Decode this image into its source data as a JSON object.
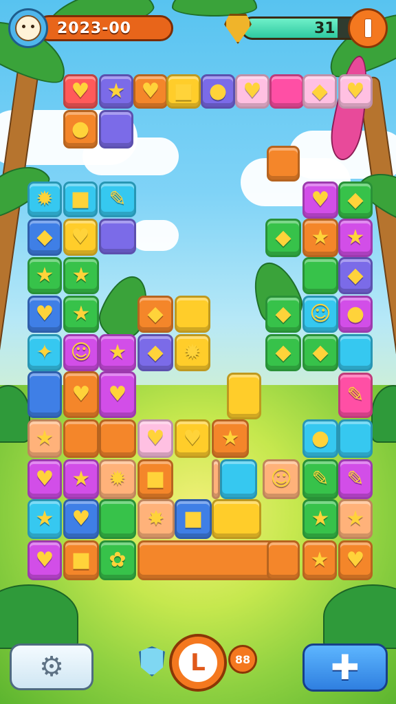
{
  "hud": {
    "score": "2023-00",
    "level_value": "31",
    "level_progress": 0.75
  },
  "icons": {
    "avatar": "avatar-face-icon",
    "gem": "gem-icon",
    "pause": "pause-icon",
    "settings": "gear-icon",
    "shield": "shield-icon",
    "add": "plus-icon"
  },
  "bottom": {
    "center_label": "L",
    "moves_badge": "88"
  },
  "palette": {
    "orange": "#f4862a",
    "purple": "#7b6be8",
    "yellow": "#ffcd2a",
    "pink": "#ff4fa5",
    "lightpink": "#ffc0e2",
    "blue": "#3f7fe6",
    "cyan": "#36c8f0",
    "green": "#37c24a",
    "magenta": "#d24ee8",
    "peach": "#ffb27a",
    "red": "#ff5a5a"
  },
  "tiles": [
    {
      "color": "orange",
      "glyph": "◆"
    },
    {
      "color": "purple",
      "glyph": "★"
    },
    {
      "color": "orange",
      "glyph": "♥"
    },
    {
      "color": "yellow",
      "glyph": "■"
    },
    {
      "color": "purple",
      "glyph": "●"
    },
    {
      "color": "lightpink",
      "glyph": "♥"
    },
    {
      "color": "pink",
      "glyph": ""
    },
    {
      "color": "lightpink",
      "glyph": "◆"
    },
    {
      "color": "lightpink",
      "glyph": "♥"
    },
    {
      "color": "orange",
      "glyph": "●"
    },
    {
      "color": "purple",
      "glyph": ""
    },
    {
      "color": "orange",
      "glyph": ""
    },
    {
      "color": "cyan",
      "glyph": "✹"
    },
    {
      "color": "cyan",
      "glyph": "■"
    },
    {
      "color": "cyan",
      "glyph": "✎"
    },
    {
      "color": "purple",
      "glyph": ""
    },
    {
      "color": "blue",
      "glyph": "◆"
    },
    {
      "color": "yellow",
      "glyph": "♥"
    },
    {
      "color": "green",
      "glyph": "★"
    },
    {
      "color": "green",
      "glyph": "★"
    },
    {
      "color": "blue",
      "glyph": "♥"
    },
    {
      "color": "green",
      "glyph": "★"
    },
    {
      "color": "cyan",
      "glyph": "✦"
    },
    {
      "color": "magenta",
      "glyph": "☺"
    },
    {
      "color": "magenta",
      "glyph": "★"
    },
    {
      "color": "blue",
      "glyph": ""
    },
    {
      "color": "orange",
      "glyph": "♥"
    },
    {
      "color": "magenta",
      "glyph": "♥"
    },
    {
      "color": "orange",
      "glyph": "◆"
    },
    {
      "color": "yellow",
      "glyph": ""
    },
    {
      "color": "purple",
      "glyph": "◆"
    },
    {
      "color": "yellow",
      "glyph": "✹"
    },
    {
      "color": "yellow",
      "glyph": ""
    },
    {
      "color": "peach",
      "glyph": "★"
    },
    {
      "color": "orange",
      "glyph": ""
    },
    {
      "color": "orange",
      "glyph": ""
    },
    {
      "color": "lightpink",
      "glyph": "♥"
    },
    {
      "color": "yellow",
      "glyph": "♥"
    },
    {
      "color": "orange",
      "glyph": "★"
    },
    {
      "color": "magenta",
      "glyph": "♥"
    },
    {
      "color": "magenta",
      "glyph": "★"
    },
    {
      "color": "peach",
      "glyph": "✹"
    },
    {
      "color": "orange",
      "glyph": "■"
    },
    {
      "color": "peach",
      "glyph": ""
    },
    {
      "color": "cyan",
      "glyph": ""
    },
    {
      "color": "peach",
      "glyph": "☺"
    },
    {
      "color": "cyan",
      "glyph": "★"
    },
    {
      "color": "blue",
      "glyph": "♥"
    },
    {
      "color": "green",
      "glyph": ""
    },
    {
      "color": "peach",
      "glyph": "✸"
    },
    {
      "color": "blue",
      "glyph": "■"
    },
    {
      "color": "yellow",
      "glyph": ""
    },
    {
      "color": "magenta",
      "glyph": "♥"
    },
    {
      "color": "orange",
      "glyph": "■"
    },
    {
      "color": "green",
      "glyph": "✿"
    },
    {
      "color": "orange",
      "glyph": ""
    },
    {
      "color": "orange",
      "glyph": ""
    },
    {
      "color": "orange",
      "glyph": "★"
    },
    {
      "color": "orange",
      "glyph": "♥"
    },
    {
      "color": "green",
      "glyph": "◆"
    },
    {
      "color": "magenta",
      "glyph": "♥"
    },
    {
      "color": "green",
      "glyph": "◆"
    },
    {
      "color": "orange",
      "glyph": "★"
    },
    {
      "color": "magenta",
      "glyph": "★"
    },
    {
      "color": "green",
      "glyph": ""
    },
    {
      "color": "purple",
      "glyph": "◆"
    },
    {
      "color": "green",
      "glyph": "◆"
    },
    {
      "color": "cyan",
      "glyph": "☺"
    },
    {
      "color": "magenta",
      "glyph": "●"
    },
    {
      "color": "green",
      "glyph": "◆"
    },
    {
      "color": "green",
      "glyph": "◆"
    },
    {
      "color": "cyan",
      "glyph": ""
    },
    {
      "color": "pink",
      "glyph": "✎"
    },
    {
      "color": "cyan",
      "glyph": ""
    },
    {
      "color": "cyan",
      "glyph": "●"
    },
    {
      "color": "green",
      "glyph": "✎"
    },
    {
      "color": "magenta",
      "glyph": "✎"
    },
    {
      "color": "green",
      "glyph": "★"
    },
    {
      "color": "peach",
      "glyph": "★"
    },
    {
      "color": "red",
      "glyph": "♥"
    }
  ]
}
